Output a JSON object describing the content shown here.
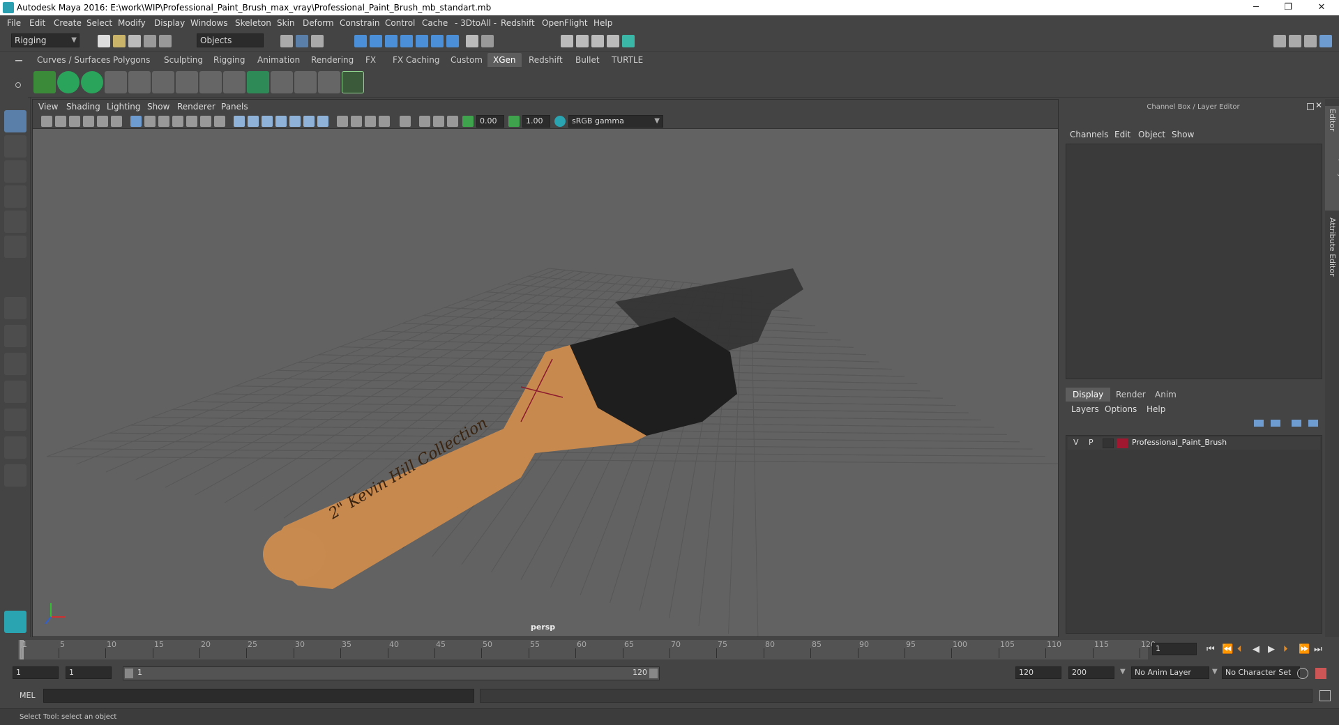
{
  "window": {
    "title": "Autodesk Maya 2016: E:\\work\\WIP\\Professional_Paint_Brush_max_vray\\Professional_Paint_Brush_mb_standart.mb",
    "min": "─",
    "max": "❐",
    "close": "✕"
  },
  "menubar": [
    "File",
    "Edit",
    "Create",
    "Select",
    "Modify",
    "Display",
    "Windows",
    "Skeleton",
    "Skin",
    "Deform",
    "Constrain",
    "Control",
    "Cache",
    "- 3DtoAll -",
    "Redshift",
    "OpenFlight",
    "Help"
  ],
  "status": {
    "menuset": "Rigging",
    "selection_mode": "Objects"
  },
  "shelf_tabs": [
    "Curves / Surfaces",
    "Polygons",
    "Sculpting",
    "Rigging",
    "Animation",
    "Rendering",
    "FX",
    "FX Caching",
    "Custom",
    "XGen",
    "Redshift",
    "Bullet",
    "TURTLE"
  ],
  "active_shelf_tab": "XGen",
  "viewport": {
    "menus": [
      "View",
      "Shading",
      "Lighting",
      "Show",
      "Renderer",
      "Panels"
    ],
    "exposure": "0.00",
    "gamma": "1.00",
    "color_space": "sRGB gamma",
    "camera": "persp",
    "handle_text": "2\" Kevin Hill Collection"
  },
  "channel_box": {
    "title": "Channel Box / Layer Editor",
    "menus": [
      "Channels",
      "Edit",
      "Object",
      "Show"
    ]
  },
  "layer_editor": {
    "tabs": [
      "Display",
      "Render",
      "Anim"
    ],
    "active_tab": "Display",
    "menus": [
      "Layers",
      "Options",
      "Help"
    ],
    "layers": [
      {
        "v": "V",
        "p": "P",
        "name": "Professional_Paint_Brush",
        "color": "#a01830"
      }
    ]
  },
  "side_tabs": [
    "Channel Box / Layer Editor",
    "Attribute Editor"
  ],
  "timeline": {
    "ticks": [
      1,
      5,
      10,
      15,
      20,
      25,
      30,
      35,
      40,
      45,
      50,
      55,
      60,
      65,
      70,
      75,
      80,
      85,
      90,
      95,
      100,
      105,
      110,
      115,
      120
    ],
    "current_frame": "1"
  },
  "range": {
    "start": "1",
    "playback_start": "1",
    "bar_start": "1",
    "bar_end": "120",
    "playback_end": "120",
    "end": "200",
    "anim_layer": "No Anim Layer",
    "character_set": "No Character Set"
  },
  "command_line": {
    "label": "MEL"
  },
  "help_line": "Select Tool: select an object",
  "colors": {
    "accent": "#5d5d5d",
    "select_blue": "#5a7fa8",
    "brush_wood": "#c8894f",
    "ferrule": "#1e1e1e",
    "layer_color": "#a01830"
  }
}
